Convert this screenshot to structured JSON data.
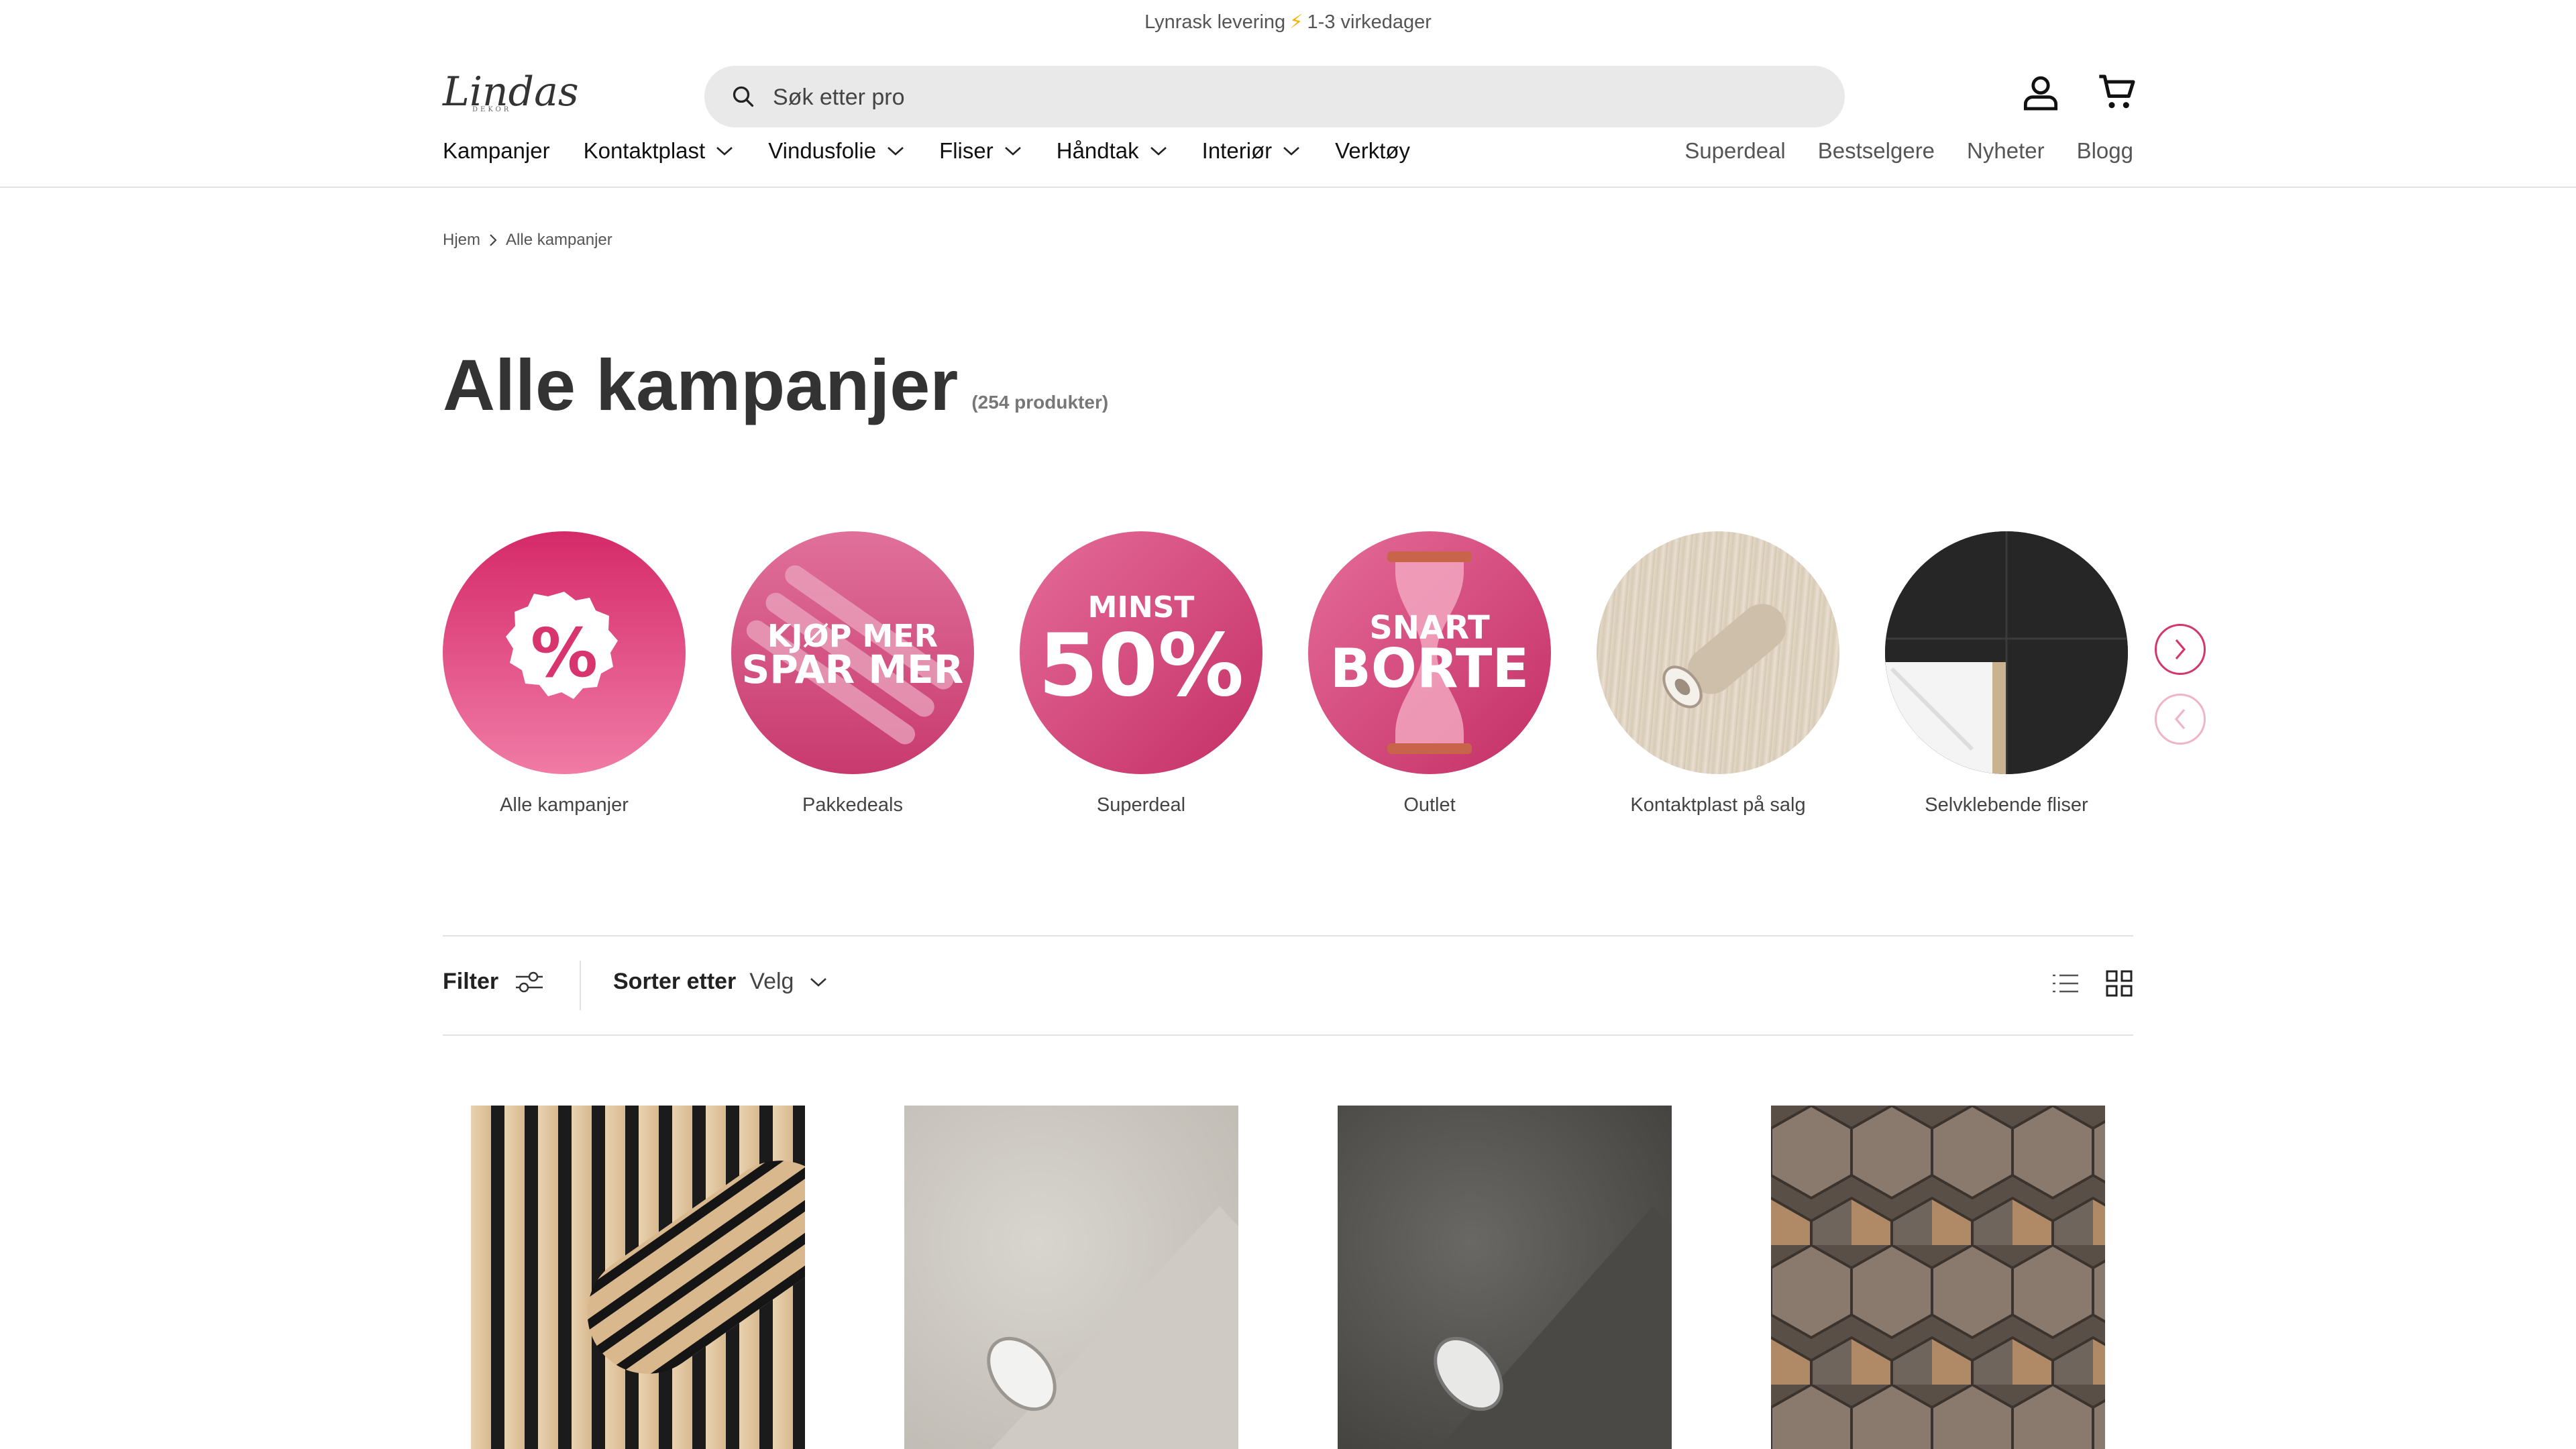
{
  "announcement": {
    "text": "Lynrask levering",
    "bolt": "⚡",
    "delivery": "1-3 virkedager"
  },
  "logo": {
    "name": "Lindas",
    "tagline": "DEKOR"
  },
  "search": {
    "placeholder": "Søk etter pro"
  },
  "header_icons": [
    "account-icon",
    "cart-icon"
  ],
  "nav": {
    "items": [
      {
        "label": "Kampanjer",
        "dropdown": false
      },
      {
        "label": "Kontaktplast",
        "dropdown": true
      },
      {
        "label": "Vindusfolie",
        "dropdown": true
      },
      {
        "label": "Fliser",
        "dropdown": true
      },
      {
        "label": "Håndtak",
        "dropdown": true
      },
      {
        "label": "Interiør",
        "dropdown": true
      },
      {
        "label": "Verktøy",
        "dropdown": false
      }
    ],
    "secondary": [
      "Superdeal",
      "Bestselgere",
      "Nyheter",
      "Blogg"
    ]
  },
  "breadcrumb": {
    "home": "Hjem",
    "current": "Alle kampanjer"
  },
  "page": {
    "title": "Alle kampanjer",
    "count": "(254 produkter)"
  },
  "categories": [
    {
      "label": "Alle kampanjer",
      "badge": "%"
    },
    {
      "label": "Pakkedeals",
      "line1": "KJØP MER",
      "line2": "SPAR MER"
    },
    {
      "label": "Superdeal",
      "line1": "MINST",
      "line2": "50%"
    },
    {
      "label": "Outlet",
      "line1": "SNART",
      "line2": "BORTE"
    },
    {
      "label": "Kontaktplast på salg"
    },
    {
      "label": "Selvklebende fliser"
    }
  ],
  "toolbar": {
    "filter": "Filter",
    "sort_label": "Sorter etter",
    "sort_value": "Velg"
  },
  "colors": {
    "accent": "#d4366e",
    "pink_light": "#f07ba5",
    "border": "#e2e2e2"
  }
}
